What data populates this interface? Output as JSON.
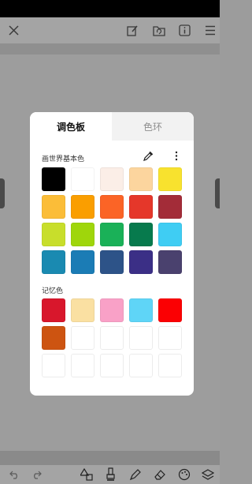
{
  "colors": {
    "overlay_bg": "#9c9c9c",
    "panel_bg": "#ffffff",
    "inactive_tab_bg": "#f2f2f2",
    "icon_color": "#3a3a3a"
  },
  "toolbar": {
    "icons": [
      "close-icon",
      "edit-icon",
      "folder-icon",
      "info-icon",
      "menu-icon"
    ]
  },
  "bottom_toolbar": {
    "icons": [
      "undo-icon",
      "redo-icon",
      "shapes-icon",
      "brush-icon",
      "pen-icon",
      "eraser-icon",
      "palette-icon",
      "layers-icon"
    ]
  },
  "palette": {
    "tabs": {
      "palette_label": "调色板",
      "ring_label": "色环"
    },
    "basic_title": "画世界基本色",
    "memory_title": "记忆色",
    "basic_colors": [
      "#000000",
      "#ffffff",
      "#fbeee7",
      "#fcd59e",
      "#f8e22e",
      "#fbbd38",
      "#fa9e00",
      "#fb6426",
      "#e5372a",
      "#a32c38",
      "#c8de2b",
      "#9fd60b",
      "#1ab158",
      "#077a4d",
      "#3fcdf3",
      "#1a8ab1",
      "#1b7cb5",
      "#2d5388",
      "#3b2f86",
      "#4a416e"
    ],
    "memory_colors": [
      "#d8172c",
      "#fae0a2",
      "#f9a1c7",
      "#5fd5f7",
      "#fb0003",
      "#cd5411",
      "",
      "",
      "",
      "",
      "",
      "",
      "",
      "",
      ""
    ]
  }
}
